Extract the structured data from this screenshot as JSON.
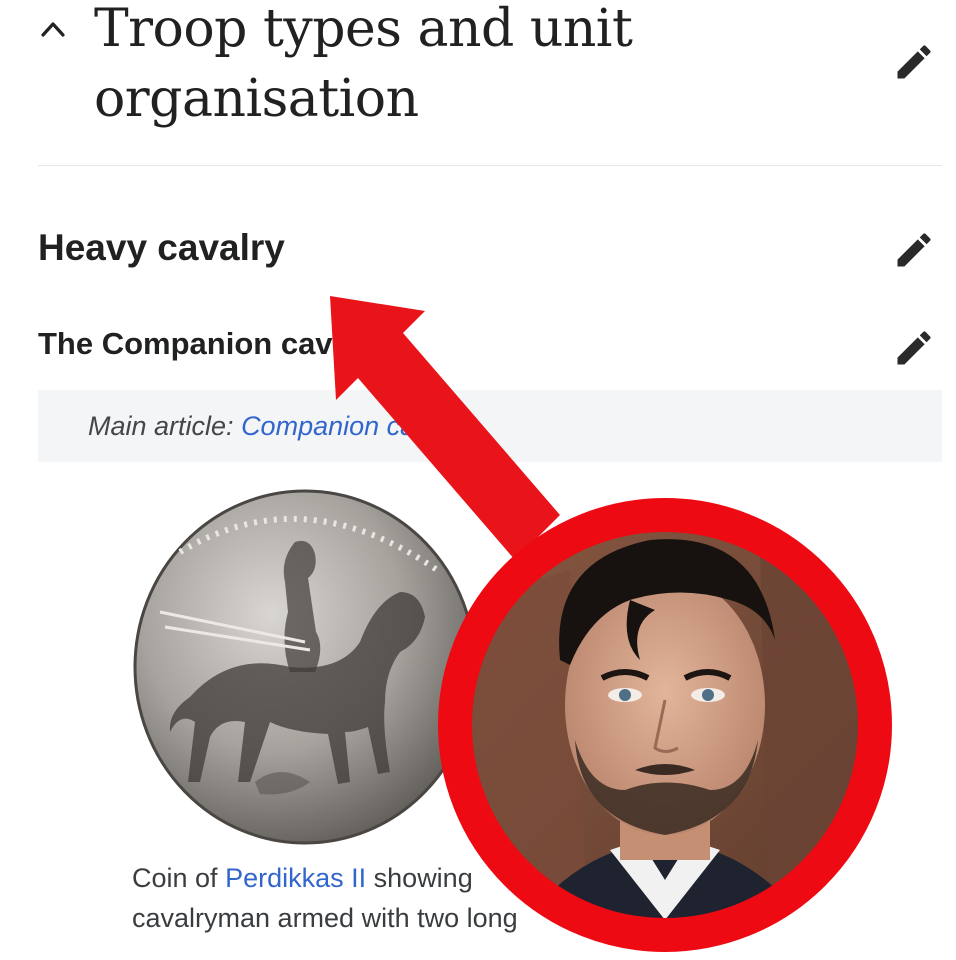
{
  "section": {
    "title": "Troop types and unit organisation",
    "collapse_icon": "chevron-up-icon",
    "edit_icon": "pencil-icon"
  },
  "subsection": {
    "title": "Heavy cavalry",
    "edit_icon": "pencil-icon"
  },
  "subsubsection": {
    "title": "The Companion cavalry",
    "edit_icon": "pencil-icon"
  },
  "hatnote": {
    "prefix": "Main article:",
    "link": "Companion cavalry"
  },
  "figure": {
    "image_icon": "coin-image",
    "caption_start": "Coin of",
    "caption_link": "Perdikkas II",
    "caption_rest": "showing",
    "caption_line2": "cavalryman armed with two long"
  },
  "overlay": {
    "arrow_color": "#e8141a",
    "circle_color": "#ee0a13",
    "photo_icon": "portrait-photo"
  },
  "colors": {
    "link": "#3366cc",
    "text": "#202122",
    "hatnote_bg": "#f3f5f7"
  }
}
